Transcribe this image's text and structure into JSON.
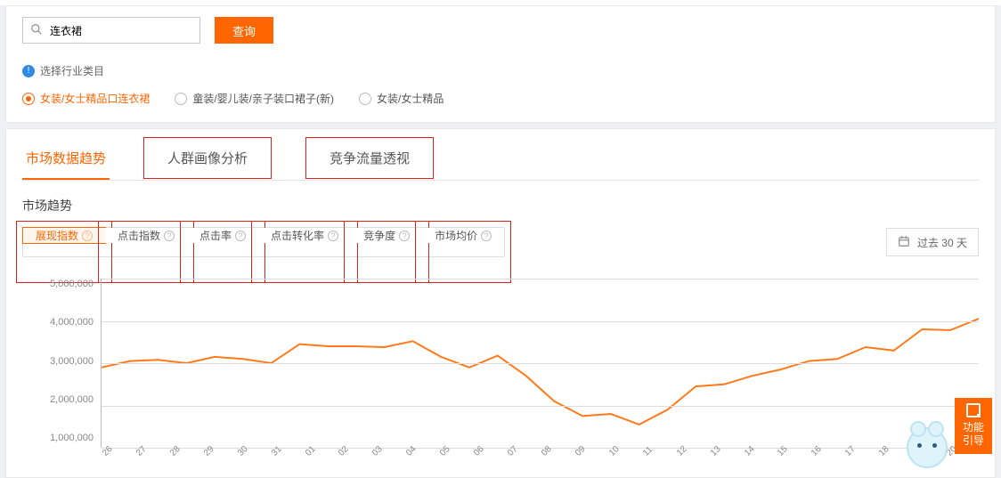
{
  "top_tabs_fragment": "",
  "search": {
    "value": "连衣裙",
    "button": "查询"
  },
  "category_select": {
    "header": "选择行业类目",
    "options": [
      {
        "label": "女装/女士精品口连衣裙",
        "selected": true
      },
      {
        "label": "童装/婴儿装/亲子装口裙子(新)",
        "selected": false
      },
      {
        "label": "女装/女士精品",
        "selected": false
      }
    ]
  },
  "tabs": {
    "t0": "市场数据趋势",
    "t1": "人群画像分析",
    "t2": "竞争流量透视"
  },
  "section_title": "市场趋势",
  "metrics": {
    "m0": "展现指数",
    "m1": "点击指数",
    "m2": "点击率",
    "m3": "点击转化率",
    "m4": "竞争度",
    "m5": "市场均价"
  },
  "date_range": "过去 30 天",
  "float_help": "功能\n引导",
  "chart_data": {
    "type": "line",
    "title": "",
    "xlabel": "",
    "ylabel": "",
    "ylim": [
      1000000,
      5000000
    ],
    "y_ticks": [
      5000000,
      4000000,
      3000000,
      2000000,
      1000000
    ],
    "y_tick_labels": [
      "5,000,000",
      "4,000,000",
      "3,000,000",
      "2,000,000",
      "1,000,000"
    ],
    "x_ticks": [
      "26",
      "27",
      "28",
      "29",
      "30",
      "31",
      "01",
      "02",
      "03",
      "04",
      "05",
      "06",
      "07",
      "08",
      "09",
      "10",
      "11",
      "12",
      "13",
      "14",
      "15",
      "16",
      "17",
      "18",
      "19",
      "20"
    ],
    "series": [
      {
        "name": "展现指数",
        "color": "#ff7a1a",
        "values": [
          2900000,
          3050000,
          3080000,
          3000000,
          3150000,
          3100000,
          3000000,
          3450000,
          3400000,
          3400000,
          3380000,
          3520000,
          3150000,
          2900000,
          3180000,
          2700000,
          2100000,
          1750000,
          1800000,
          1550000,
          1900000,
          2450000,
          2500000,
          2700000,
          2850000,
          3050000,
          3100000,
          3380000,
          3300000,
          3800000,
          3780000,
          4050000
        ]
      }
    ]
  }
}
